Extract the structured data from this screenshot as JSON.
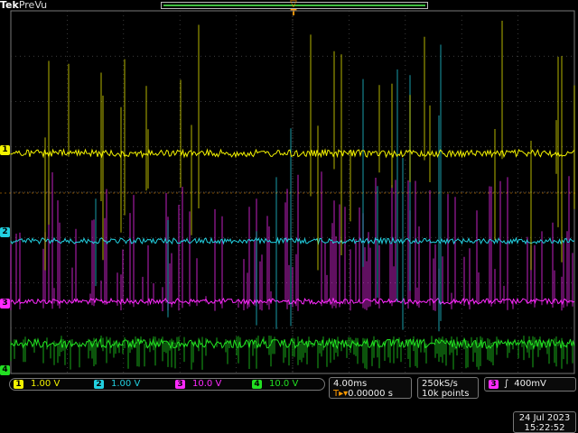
{
  "header": {
    "brand_prefix": "Tek",
    "brand_mode": "PreVu"
  },
  "colors": {
    "ch1": "#f2f200",
    "ch2": "#22d0e0",
    "ch3": "#ff2aff",
    "ch4": "#22e022",
    "trigger": "#ff9a00",
    "grid": "#505050"
  },
  "channels": [
    {
      "id": "1",
      "scale": "1.00 V",
      "color": "#f2f200"
    },
    {
      "id": "2",
      "scale": "1.00 V",
      "color": "#22d0e0"
    },
    {
      "id": "3",
      "scale": "10.0 V",
      "color": "#ff2aff"
    },
    {
      "id": "4",
      "scale": "10.0 V",
      "color": "#22e022"
    }
  ],
  "timebase": {
    "scale": "4.00ms",
    "trigger_position": "0.00000 s"
  },
  "acquisition": {
    "sample_rate": "250kS/s",
    "record_length": "10k points"
  },
  "trigger": {
    "source": "3",
    "level": "400mV"
  },
  "datetime": {
    "date": "24 Jul  2023",
    "time": "15:22:52"
  }
}
